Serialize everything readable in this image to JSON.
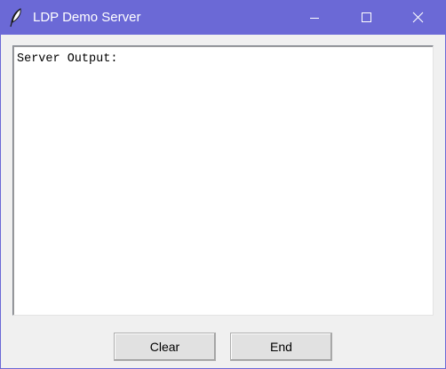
{
  "window": {
    "title": "LDP Demo Server",
    "icon": "feather-icon",
    "accent_color": "#6b69d6",
    "controls": {
      "minimize_icon": "minimize-icon",
      "maximize_icon": "maximize-icon",
      "close_icon": "close-icon"
    }
  },
  "output": {
    "text": "Server Output:"
  },
  "buttons": {
    "clear_label": "Clear",
    "end_label": "End"
  }
}
